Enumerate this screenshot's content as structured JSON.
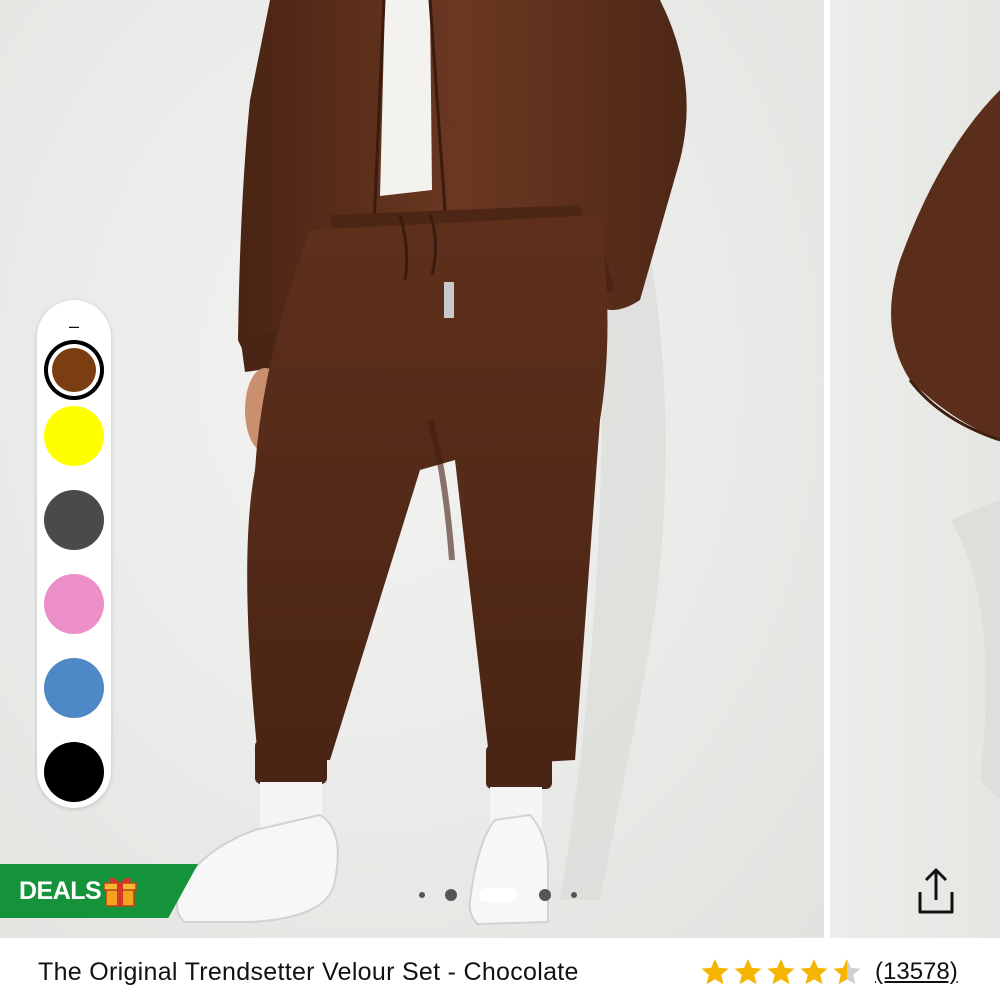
{
  "product": {
    "title": "The Original Trendsetter Velour Set - Chocolate",
    "rating": 4.5,
    "review_count": "(13578)"
  },
  "swatch_rail": {
    "collapse_symbol": "–",
    "colors": [
      {
        "name": "chocolate",
        "hex": "#7a3e10",
        "selected": true
      },
      {
        "name": "yellow",
        "hex": "#ffff00",
        "selected": false
      },
      {
        "name": "charcoal",
        "hex": "#4a4a4a",
        "selected": false
      },
      {
        "name": "pink",
        "hex": "#ec8ec7",
        "selected": false
      },
      {
        "name": "blue",
        "hex": "#4e88c6",
        "selected": false
      },
      {
        "name": "black",
        "hex": "#000000",
        "selected": false
      }
    ]
  },
  "deals_badge": {
    "label": "DEALS",
    "icon": "gift-icon",
    "color": "#14933b"
  },
  "gallery": {
    "slide_count": 5,
    "active_slide": 3
  },
  "share": {
    "icon": "share-icon"
  },
  "colors": {
    "star": "#f5b400",
    "star_empty": "#cfcfcf",
    "velour": "#5a2e1a"
  }
}
